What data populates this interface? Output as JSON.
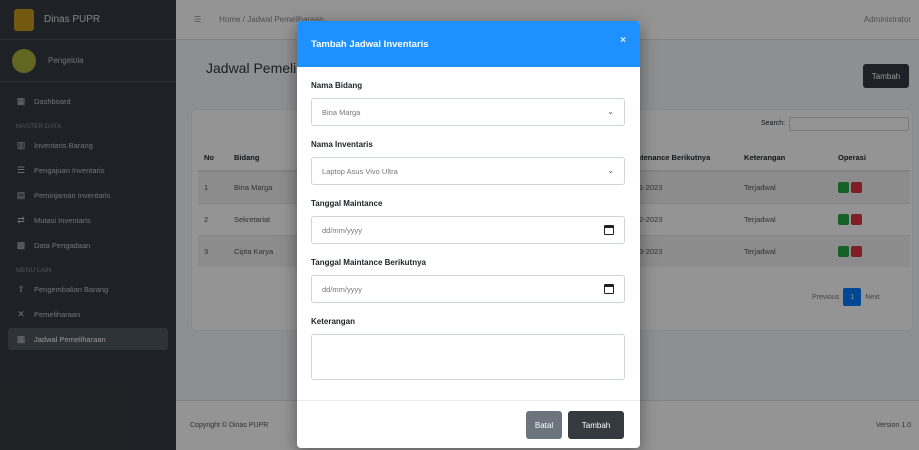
{
  "brand": {
    "title": "Dinas PUPR"
  },
  "user": {
    "name": "Pengelola"
  },
  "sidebar": {
    "items": [
      {
        "label": "Dashboard",
        "icon": "dashboard-icon"
      },
      {
        "header": "MASTER DATA"
      },
      {
        "label": "Inventaris Barang",
        "icon": "chart-icon"
      },
      {
        "label": "Pengajuan Inventaris",
        "icon": "form-icon"
      },
      {
        "label": "Peminjaman Inventaris",
        "icon": "list-icon"
      },
      {
        "label": "Mutasi Inventaris",
        "icon": "exchange-icon"
      },
      {
        "label": "Data Pengadaan",
        "icon": "table-icon"
      },
      {
        "header": "MENU LAIN"
      },
      {
        "label": "Pengembalian Barang",
        "icon": "upload-icon"
      },
      {
        "label": "Pemeliharaan",
        "icon": "tools-icon"
      },
      {
        "label": "Jadwal Pemeliharaan",
        "icon": "calendar-icon",
        "active": true
      }
    ]
  },
  "topbar": {
    "home": "Home",
    "crumb": "Jadwal Pemeliharaan",
    "admin": "Administrator"
  },
  "page": {
    "title": "Jadwal Pemeliharaan",
    "add_label": "Tambah"
  },
  "search": {
    "label": "Search:"
  },
  "table": {
    "columns": [
      "No",
      "Bidang",
      "Maintenance Berikutnya",
      "Keterangan",
      "Operasi"
    ],
    "rows": [
      {
        "no": "1",
        "bidang": "Bina Marga",
        "next": "12-01-2023",
        "ket": "Terjadwal"
      },
      {
        "no": "2",
        "bidang": "Sekretariat",
        "next": "20-02-2023",
        "ket": "Terjadwal"
      },
      {
        "no": "3",
        "bidang": "Cipta Karya",
        "next": "05-03-2023",
        "ket": "Terjadwal"
      }
    ]
  },
  "pager": {
    "prev": "Previous",
    "current": "1",
    "next": "Next"
  },
  "footer": {
    "copyright": "Copyright © Dinas PUPR",
    "version": "Version 1.0"
  },
  "modal": {
    "title": "Tambah Jadwal Inventaris",
    "close": "×",
    "fields": {
      "bidang_label": "Nama Bidang",
      "bidang_value": "Bina Marga",
      "inventaris_label": "Nama Inventaris",
      "inventaris_value": "Laptop Asus Vivo Ultra",
      "tgl_label": "Tanggal Maintance",
      "tgl_value": "dd/mm/yyyy",
      "tgl_next_label": "Tanggal Maintance Berikutnya",
      "tgl_next_value": "dd/mm/yyyy",
      "ket_label": "Keterangan"
    },
    "back": "Batal",
    "save": "Tambah"
  }
}
